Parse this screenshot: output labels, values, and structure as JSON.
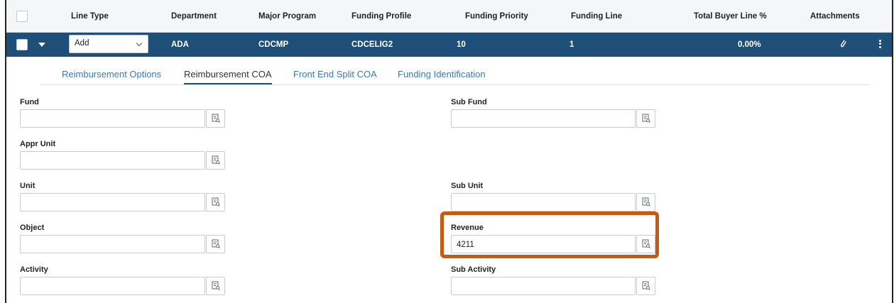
{
  "header": {
    "columns": [
      "Line Type",
      "Department",
      "Major Program",
      "Funding Profile",
      "Funding Priority",
      "Funding Line",
      "Total Buyer Line %",
      "Attachments"
    ]
  },
  "row": {
    "line_type": "Add",
    "department": "ADA",
    "major_program": "CDCMP",
    "funding_profile": "CDCELIG2",
    "funding_priority": "10",
    "funding_line": "1",
    "total_buyer_line_pct": "0.00%"
  },
  "tabs": [
    "Reimbursement Options",
    "Reimbursement COA",
    "Front End Split COA",
    "Funding Identification"
  ],
  "active_tab": "Reimbursement COA",
  "fields": {
    "fund": {
      "label": "Fund",
      "value": ""
    },
    "sub_fund": {
      "label": "Sub Fund",
      "value": ""
    },
    "appr_unit": {
      "label": "Appr Unit",
      "value": ""
    },
    "unit": {
      "label": "Unit",
      "value": ""
    },
    "sub_unit": {
      "label": "Sub Unit",
      "value": ""
    },
    "object": {
      "label": "Object",
      "value": ""
    },
    "revenue": {
      "label": "Revenue",
      "value": "4211"
    },
    "activity": {
      "label": "Activity",
      "value": ""
    },
    "sub_activity": {
      "label": "Sub Activity",
      "value": ""
    }
  },
  "icons": {
    "lookup": "lookup-icon",
    "attachment": "paperclip-icon",
    "more": "kebab-menu-icon",
    "expand": "chevron-down-icon"
  },
  "colors": {
    "row_bg": "#1d4f79",
    "tab_link": "#3d7aa8",
    "highlight": "#c55a11"
  }
}
